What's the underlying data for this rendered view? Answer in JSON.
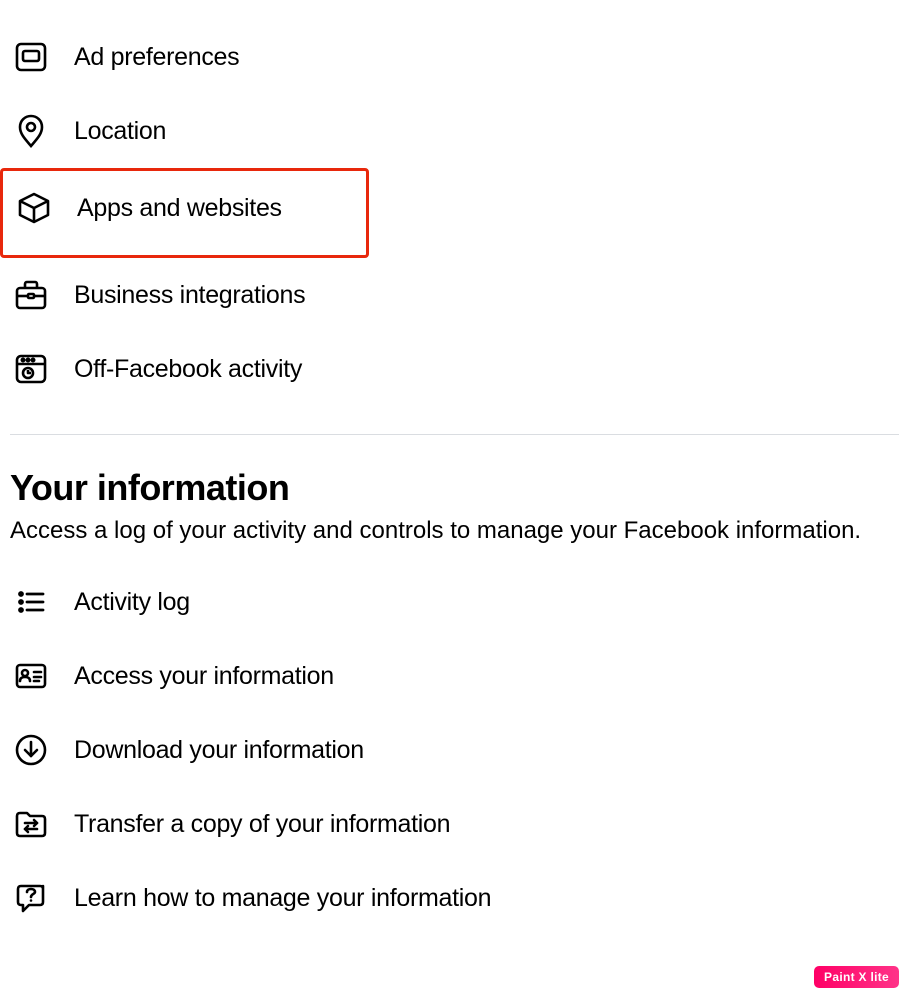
{
  "menu_top": {
    "ad_preferences": "Ad preferences",
    "location": "Location",
    "apps_websites": "Apps and websites",
    "business_integrations": "Business integrations",
    "off_facebook_activity": "Off-Facebook activity"
  },
  "section": {
    "title": "Your information",
    "description": "Access a log of your activity and controls to manage your Facebook information."
  },
  "menu_info": {
    "activity_log": "Activity log",
    "access_info": "Access your information",
    "download_info": "Download your information",
    "transfer_copy": "Transfer a copy of your information",
    "learn_manage": "Learn how to manage your information"
  },
  "watermark": "Paint X lite"
}
